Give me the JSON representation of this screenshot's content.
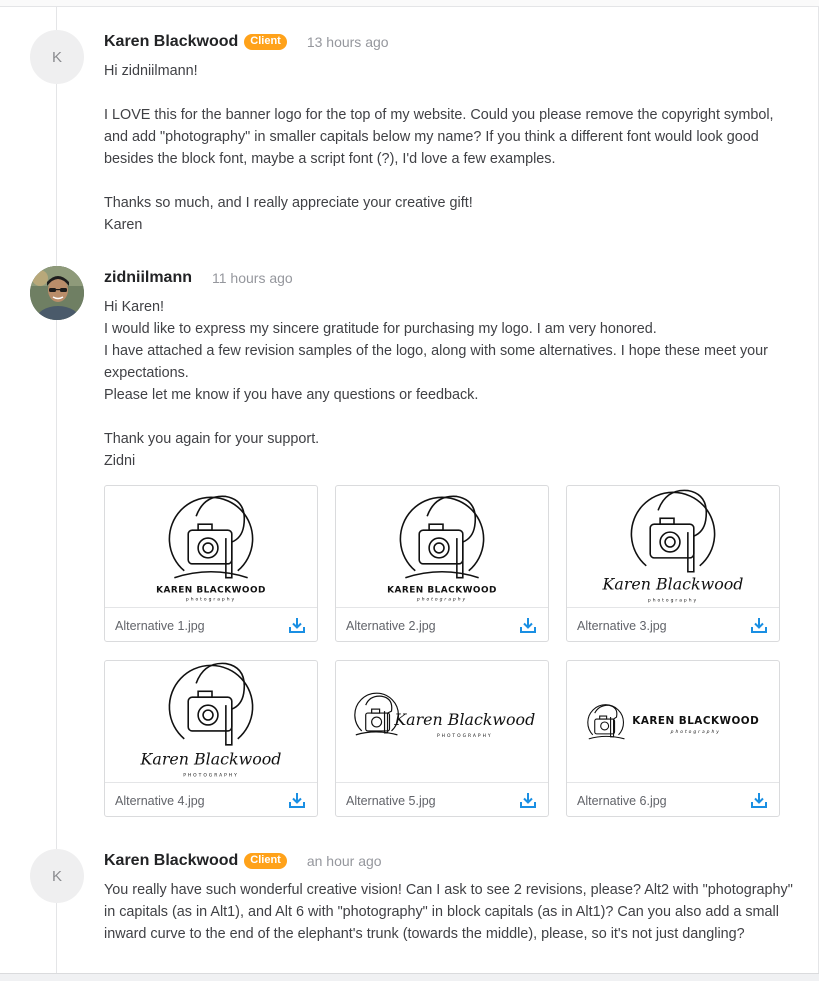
{
  "messages": [
    {
      "avatar_letter": "K",
      "sender": "Karen Blackwood",
      "badge": "Client",
      "time": "13 hours ago",
      "paragraphs": [
        "Hi zidniilmann!",
        "",
        "I LOVE this for the banner logo for the top of my website. Could you please remove the copyright symbol, and add \"photography\" in smaller capitals below my name? If you think a different font would look good besides the block font, maybe a script font (?), I'd love a few examples.",
        "",
        "Thanks so much, and I really appreciate your creative gift!",
        "Karen"
      ]
    },
    {
      "sender": "zidniilmann",
      "time": "11 hours ago",
      "paragraphs": [
        "Hi Karen!",
        "I would like to express my sincere gratitude for purchasing my logo. I am very honored.",
        "I have attached a few revision samples of the logo, along with some alternatives. I hope these meet your expectations.",
        "Please let me know if you have any questions or feedback.",
        "",
        "Thank you again for your support.",
        "Zidni"
      ],
      "attachments": [
        {
          "name": "Alternative 1.jpg",
          "logo_name": "KAREN BLACKWOOD",
          "logo_sub": "photography"
        },
        {
          "name": "Alternative 2.jpg",
          "logo_name": "KAREN BLACKWOOD",
          "logo_sub": "photography"
        },
        {
          "name": "Alternative 3.jpg",
          "logo_name": "Karen Blackwood",
          "logo_sub": "photography"
        },
        {
          "name": "Alternative 4.jpg",
          "logo_name": "Karen Blackwood",
          "logo_sub": "PHOTOGRAPHY"
        },
        {
          "name": "Alternative 5.jpg",
          "logo_name": "Karen Blackwood",
          "logo_sub": "PHOTOGRAPHY"
        },
        {
          "name": "Alternative 6.jpg",
          "logo_name": "KAREN BLACKWOOD",
          "logo_sub": "photography"
        }
      ]
    },
    {
      "avatar_letter": "K",
      "sender": "Karen Blackwood",
      "badge": "Client",
      "time": "an hour ago",
      "paragraphs": [
        "You really have such wonderful creative vision! Can I ask to see 2 revisions, please? Alt2 with \"photography\" in capitals (as in Alt1), and Alt 6 with \"photography\" in block capitals (as in Alt1)? Can you also add a small inward curve to the end of the elephant's trunk (towards the middle), please, so it's not just dangling?"
      ]
    }
  ],
  "colors": {
    "badge": "#ffa21a",
    "download_icon": "#1dbf73",
    "download_icon_blue": "#1a8fe3"
  },
  "icons": {
    "download": "download-icon"
  }
}
